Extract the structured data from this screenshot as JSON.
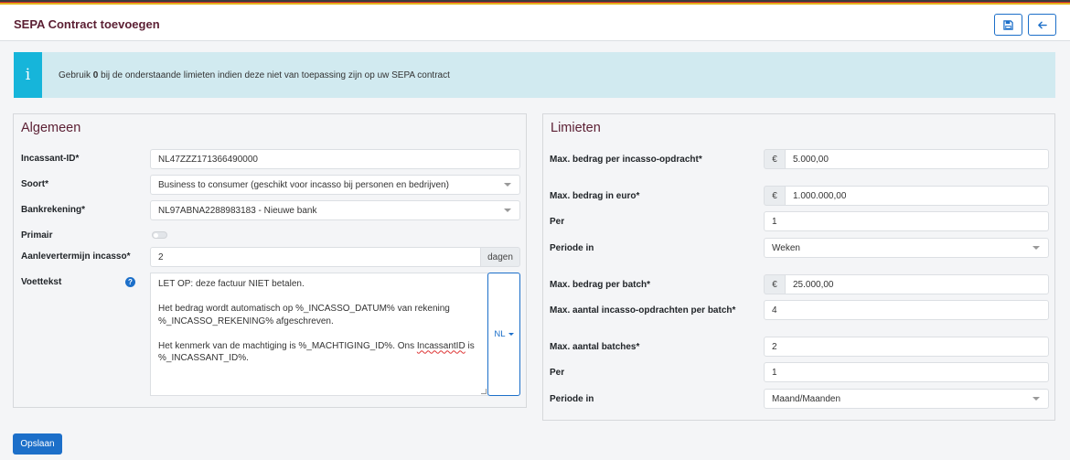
{
  "colors": {
    "flag_stripe_1": "#3c3c3c",
    "flag_stripe_2": "#c9282c",
    "flag_stripe_3": "#e3b21b",
    "title": "#5b1f33",
    "primary": "#1c6fc9",
    "info_bar": "#16b5da",
    "info_bg": "#d1eaf0"
  },
  "header": {
    "title": "SEPA Contract toevoegen",
    "save_icon": "floppy-disk-icon",
    "back_icon": "arrow-left-icon"
  },
  "info": {
    "icon": "info-icon",
    "text_before": "Gebruik ",
    "text_bold": "0",
    "text_after": " bij de onderstaande limieten indien deze niet van toepassing zijn op uw SEPA contract"
  },
  "algemeen": {
    "title": "Algemeen",
    "incassant_label": "Incassant-ID*",
    "incassant_value": "NL47ZZZ171366490000",
    "soort_label": "Soort*",
    "soort_value": "Business to consumer (geschikt voor incasso bij personen en bedrijven)",
    "bankrekening_label": "Bankrekening*",
    "bankrekening_value": "NL97ABNA2288983183 - Nieuwe bank",
    "primair_label": "Primair",
    "aanlever_label": "Aanlevertermijn incasso*",
    "aanlever_value": "2",
    "aanlever_unit": "dagen",
    "voettekst_label": "Voettekst",
    "help_glyph": "?",
    "voettekst_line1": "LET OP: deze factuur NIET betalen.",
    "voettekst_line2": "Het bedrag wordt automatisch op %_INCASSO_DATUM% van rekening %_INCASSO_REKENING% afgeschreven.",
    "voettekst_line3_pre": "Het kenmerk van de machtiging is %_MACHTIGING_ID%. Ons ",
    "voettekst_line3_mis": "IncassantID",
    "voettekst_line3_post": " is %_INCASSANT_ID%.",
    "lang_label": "NL"
  },
  "limieten": {
    "title": "Limieten",
    "currency": "€",
    "max_opdracht_label": "Max. bedrag per incasso-opdracht*",
    "max_opdracht_value": "5.000,00",
    "max_euro_label": "Max. bedrag in euro*",
    "max_euro_value": "1.000.000,00",
    "per1_label": "Per",
    "per1_value": "1",
    "periode1_label": "Periode in",
    "periode1_value": "Weken",
    "max_batch_label": "Max. bedrag per batch*",
    "max_batch_value": "25.000,00",
    "max_aantal_label": "Max. aantal incasso-opdrachten per batch*",
    "max_aantal_value": "4",
    "max_batches_label": "Max. aantal batches*",
    "max_batches_value": "2",
    "per2_label": "Per",
    "per2_value": "1",
    "periode2_label": "Periode in",
    "periode2_value": "Maand/Maanden"
  },
  "footer": {
    "save_label": "Opslaan"
  }
}
